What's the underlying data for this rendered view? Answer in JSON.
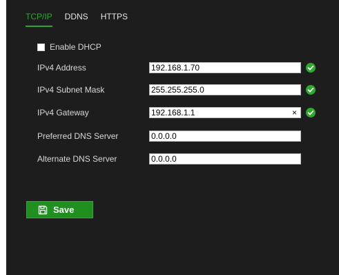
{
  "tabs": [
    {
      "label": "TCP/IP",
      "active": true
    },
    {
      "label": "DDNS",
      "active": false
    },
    {
      "label": "HTTPS",
      "active": false
    }
  ],
  "dhcp": {
    "label": "Enable DHCP",
    "checked": false
  },
  "fields": {
    "ipv4_address": {
      "label": "IPv4 Address",
      "value": "192.168.1.70",
      "valid": true
    },
    "ipv4_subnet_mask": {
      "label": "IPv4 Subnet Mask",
      "value": "255.255.255.0",
      "valid": true
    },
    "ipv4_gateway": {
      "label": "IPv4 Gateway",
      "value": "192.168.1.1",
      "valid": true,
      "clear_icon": "×"
    },
    "preferred_dns": {
      "label": "Preferred DNS Server",
      "value": "0.0.0.0"
    },
    "alternate_dns": {
      "label": "Alternate DNS Server",
      "value": "0.0.0.0"
    }
  },
  "save_button": {
    "label": "Save",
    "icon": "floppy-disk-icon"
  },
  "colors": {
    "accent": "#2ea82e",
    "panel_background": "#1d1d1d",
    "save_button": "#1f8f1f",
    "valid_check": "#2ea82e"
  }
}
